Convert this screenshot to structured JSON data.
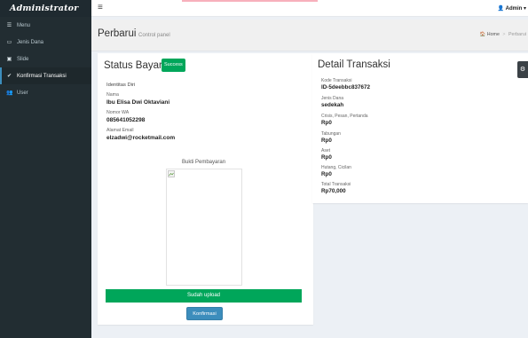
{
  "brand": "Administrator",
  "sidebar": {
    "items": [
      {
        "label": "Menu",
        "icon": "list-icon"
      },
      {
        "label": "Jenis Dana",
        "icon": "credit-card-icon"
      },
      {
        "label": "Slide",
        "icon": "image-icon"
      },
      {
        "label": "Konfirmasi Transaksi",
        "icon": "check-icon"
      },
      {
        "label": "User",
        "icon": "users-icon"
      }
    ]
  },
  "topbar": {
    "admin_label": "Admin"
  },
  "header": {
    "title": "Perbarui",
    "subtitle": "Control panel",
    "breadcrumb_home": "Home",
    "breadcrumb_current": "Perbarui"
  },
  "status": {
    "title": "Status Bayar",
    "badge": "Success",
    "identity_heading": "Identitas Diri",
    "fields": [
      {
        "label": "Nama",
        "value": "Ibu Elisa Dwi Oktaviani"
      },
      {
        "label": "Nomor WA",
        "value": "085641052298"
      },
      {
        "label": "Alamat Email",
        "value": "elzadwi@rocketmail.com"
      }
    ],
    "bukti_label": "Bukti Pembayaran",
    "upload_button": "Sudah upload",
    "konfirmasi_button": "Konfirmasi"
  },
  "detail": {
    "title": "Detail Transaksi",
    "fields": [
      {
        "label": "Kode Transaksi",
        "value": "ID-5deebbc837672"
      },
      {
        "label": "Jenis Dana",
        "value": "sedekah"
      },
      {
        "label": "Crisis, Pesan, Pertanda",
        "value": "Rp0"
      },
      {
        "label": "Tabungan",
        "value": "Rp0"
      },
      {
        "label": "Aset",
        "value": "Rp0"
      },
      {
        "label": "Hutang, Cicilan",
        "value": "Rp0"
      },
      {
        "label": "Total Transaksi",
        "value": "Rp70,000"
      }
    ]
  },
  "colors": {
    "success": "#00a65a",
    "primary": "#3c8dbc",
    "sidebar": "#222d32"
  }
}
